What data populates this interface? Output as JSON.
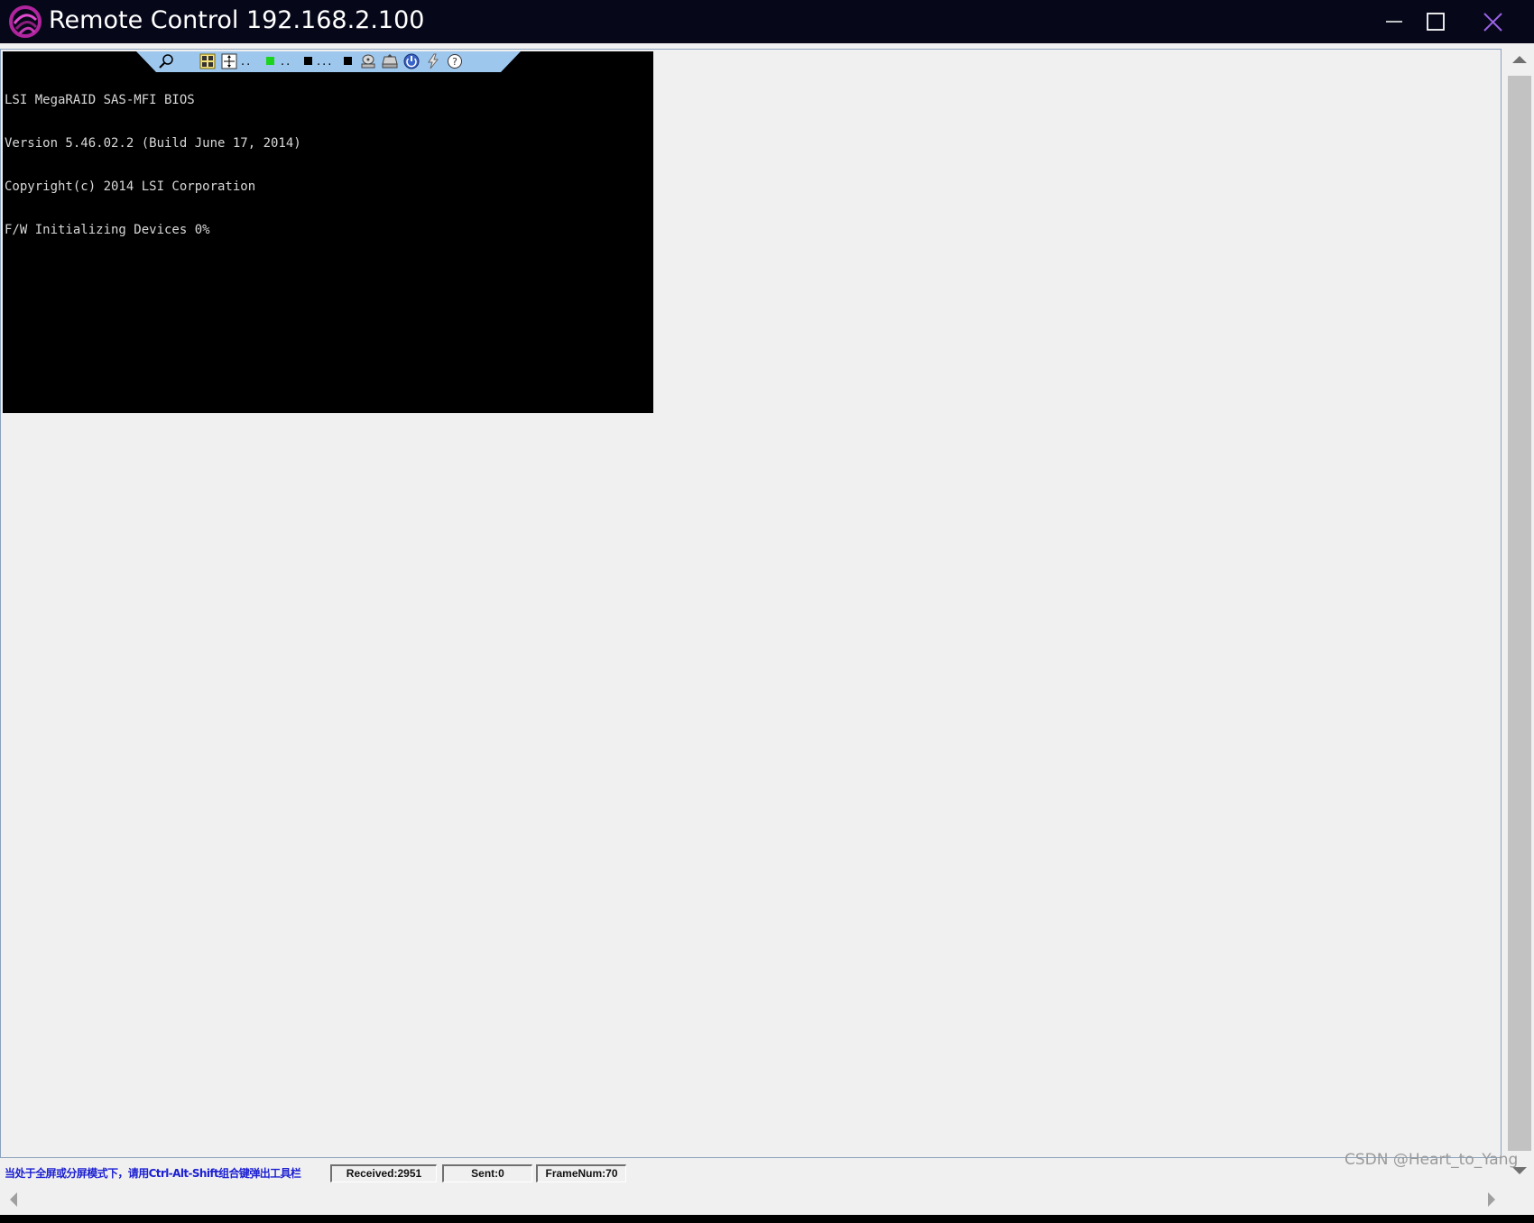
{
  "window": {
    "title": "Remote Control 192.168.2.100",
    "app_icon": "swirl-logo-icon",
    "controls": [
      "minimize-icon",
      "maximize-icon",
      "close-icon"
    ]
  },
  "console": {
    "lines": [
      "LSI MegaRAID SAS-MFI BIOS",
      "Version 5.46.02.2 (Build June 17, 2014)",
      "Copyright(c) 2014 LSI Corporation",
      "F/W Initializing Devices 0%"
    ]
  },
  "toolbar": {
    "items": [
      "pin-icon",
      "keyboard-layout-icon",
      "fit-screen-icon",
      "green-status-indicator",
      "black-status-indicator",
      "black-status-indicator",
      "disk-drive-icon",
      "floppy-drive-icon",
      "power-icon",
      "lightning-icon",
      "help-icon"
    ],
    "accent_color": "#9ec7ee"
  },
  "status": {
    "hint": "当处于全屏或分屏模式下，请用Ctrl-Alt-Shift组合键弹出工具栏",
    "received": "Received:2951",
    "sent": "Sent:0",
    "frame_num": "FrameNum:70"
  },
  "watermark": "CSDN @Heart_to_Yang",
  "colors": {
    "title_bar": "#06081a",
    "hint_text": "#1b1fd1",
    "close_icon": "#9b63e6"
  }
}
